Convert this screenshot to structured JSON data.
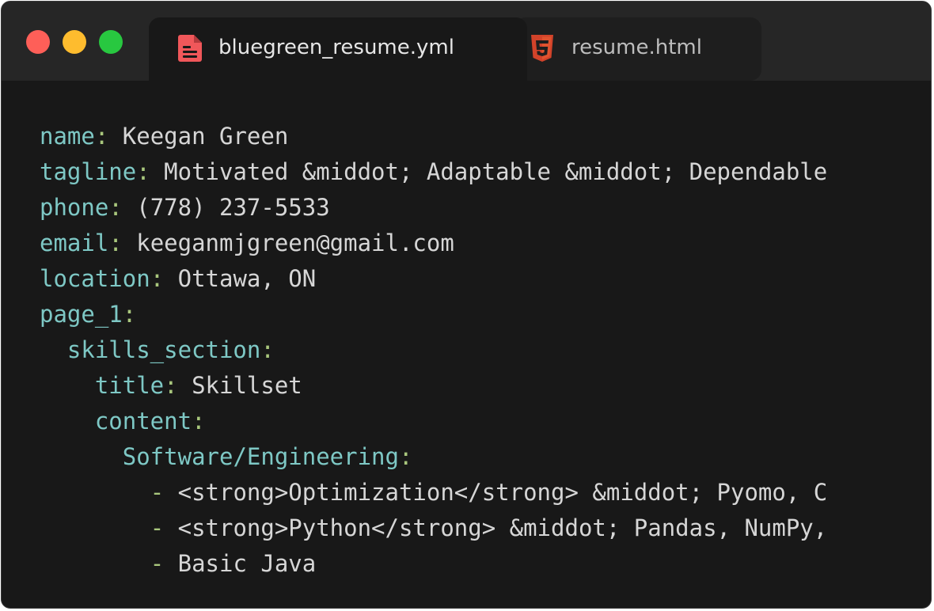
{
  "window": {
    "controls": [
      "close",
      "minimize",
      "maximize"
    ],
    "colors": {
      "close": "#fe5f58",
      "minimize": "#febc2e",
      "maximize": "#28c840"
    }
  },
  "tabs": [
    {
      "label": "bluegreen_resume.yml",
      "icon": "yaml-file-icon",
      "active": true
    },
    {
      "label": "resume.html",
      "icon": "html5-icon",
      "active": false
    }
  ],
  "editor": {
    "lines": [
      {
        "indent": "",
        "key": "name",
        "colon": ":",
        "value": " Keegan Green"
      },
      {
        "indent": "",
        "key": "tagline",
        "colon": ":",
        "value": " Motivated &middot; Adaptable &middot; Dependable"
      },
      {
        "indent": "",
        "key": "phone",
        "colon": ":",
        "value": " (778) 237-5533"
      },
      {
        "indent": "",
        "key": "email",
        "colon": ":",
        "value": " keeganmjgreen@gmail.com"
      },
      {
        "indent": "",
        "key": "location",
        "colon": ":",
        "value": " Ottawa, ON"
      },
      {
        "indent": "",
        "key": "page_1",
        "colon": ":",
        "value": ""
      },
      {
        "indent": "  ",
        "key": "skills_section",
        "colon": ":",
        "value": ""
      },
      {
        "indent": "    ",
        "key": "title",
        "colon": ":",
        "value": " Skillset"
      },
      {
        "indent": "    ",
        "key": "content",
        "colon": ":",
        "value": ""
      },
      {
        "indent": "      ",
        "key": "Software/Engineering",
        "colon": ":",
        "value": ""
      },
      {
        "indent": "        ",
        "dash": "-",
        "value": " <strong>Optimization</strong> &middot; Pyomo, C"
      },
      {
        "indent": "        ",
        "dash": "-",
        "value": " <strong>Python</strong> &middot; Pandas, NumPy,"
      },
      {
        "indent": "        ",
        "dash": "-",
        "value": " Basic Java"
      }
    ]
  }
}
